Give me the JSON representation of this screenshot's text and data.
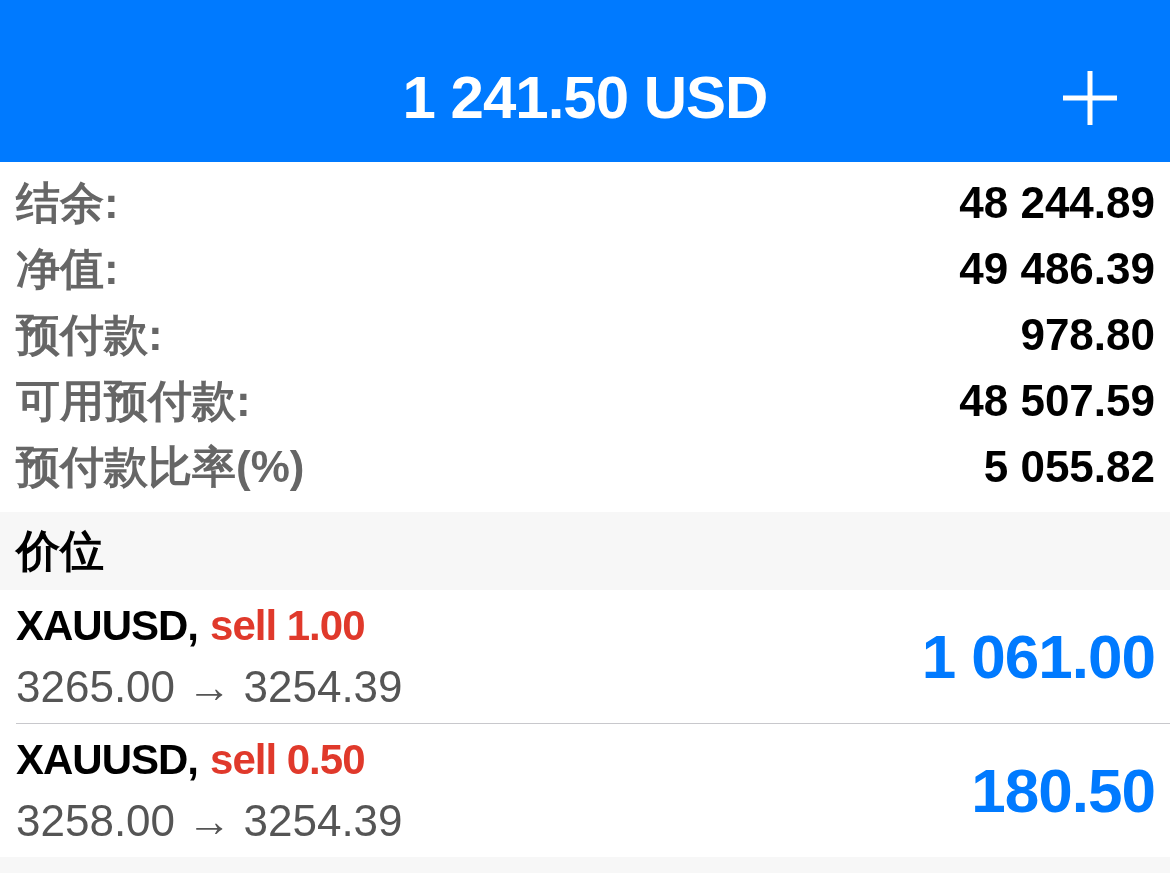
{
  "header": {
    "title": "1 241.50 USD"
  },
  "summary": [
    {
      "label": "结余:",
      "value": "48 244.89"
    },
    {
      "label": "净值:",
      "value": "49 486.39"
    },
    {
      "label": "预付款:",
      "value": "978.80"
    },
    {
      "label": "可用预付款:",
      "value": "48 507.59"
    },
    {
      "label": "预付款比率(%)",
      "value": "5 055.82"
    }
  ],
  "section": {
    "title": "价位"
  },
  "positions": [
    {
      "symbol": "XAUUSD,",
      "side": "sell 1.00",
      "prices": "3265.00 → 3254.39",
      "profit": "1 061.00"
    },
    {
      "symbol": "XAUUSD,",
      "side": "sell 0.50",
      "prices": "3258.00 → 3254.39",
      "profit": "180.50"
    }
  ]
}
